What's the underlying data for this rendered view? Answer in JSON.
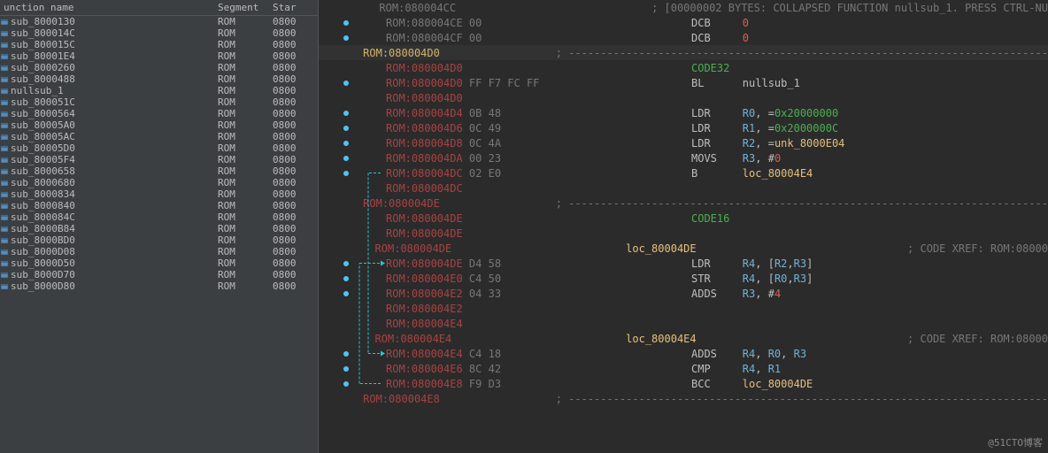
{
  "header": {
    "name": "unction name",
    "segment": "Segment",
    "star": "Star"
  },
  "functions": [
    {
      "name": "sub_8000130",
      "seg": "ROM",
      "star": "0800"
    },
    {
      "name": "sub_800014C",
      "seg": "ROM",
      "star": "0800"
    },
    {
      "name": "sub_800015C",
      "seg": "ROM",
      "star": "0800"
    },
    {
      "name": "sub_80001E4",
      "seg": "ROM",
      "star": "0800"
    },
    {
      "name": "sub_8000260",
      "seg": "ROM",
      "star": "0800"
    },
    {
      "name": "sub_8000488",
      "seg": "ROM",
      "star": "0800"
    },
    {
      "name": "nullsub_1",
      "seg": "ROM",
      "star": "0800"
    },
    {
      "name": "sub_800051C",
      "seg": "ROM",
      "star": "0800"
    },
    {
      "name": "sub_8000564",
      "seg": "ROM",
      "star": "0800"
    },
    {
      "name": "sub_80005A0",
      "seg": "ROM",
      "star": "0800"
    },
    {
      "name": "sub_80005AC",
      "seg": "ROM",
      "star": "0800"
    },
    {
      "name": "sub_80005D0",
      "seg": "ROM",
      "star": "0800"
    },
    {
      "name": "sub_80005F4",
      "seg": "ROM",
      "star": "0800"
    },
    {
      "name": "sub_8000658",
      "seg": "ROM",
      "star": "0800"
    },
    {
      "name": "sub_8000680",
      "seg": "ROM",
      "star": "0800"
    },
    {
      "name": "sub_8000834",
      "seg": "ROM",
      "star": "0800"
    },
    {
      "name": "sub_8000840",
      "seg": "ROM",
      "star": "0800"
    },
    {
      "name": "sub_800084C",
      "seg": "ROM",
      "star": "0800"
    },
    {
      "name": "sub_8000B84",
      "seg": "ROM",
      "star": "0800"
    },
    {
      "name": "sub_8000BD0",
      "seg": "ROM",
      "star": "0800"
    },
    {
      "name": "sub_8000D08",
      "seg": "ROM",
      "star": "0800"
    },
    {
      "name": "sub_8000D50",
      "seg": "ROM",
      "star": "0800"
    },
    {
      "name": "sub_8000D70",
      "seg": "ROM",
      "star": "0800"
    },
    {
      "name": "sub_8000D80",
      "seg": "ROM",
      "star": "0800"
    }
  ],
  "code": [
    {
      "dot": false,
      "romClass": "rom-gray",
      "addr": "ROM:080004CC",
      "bytes": "",
      "asm": "; [00000002 BYTES: COLLAPSED FUNCTION nullsub_1. PRESS CTRL-NU",
      "asmClass": "comment"
    },
    {
      "dot": true,
      "romClass": "rom-gray",
      "addr": "ROM:080004CE",
      "bytes": "00",
      "asmParts": [
        {
          "t": "DCB     ",
          "c": "mnemonic"
        },
        {
          "t": "0",
          "c": "num"
        }
      ]
    },
    {
      "dot": true,
      "romClass": "rom-gray",
      "addr": "ROM:080004CF",
      "bytes": "00",
      "asmParts": [
        {
          "t": "DCB     ",
          "c": "mnemonic"
        },
        {
          "t": "0",
          "c": "num"
        }
      ]
    },
    {
      "dot": false,
      "romClass": "rom-brown",
      "addr": "ROM:080004D0",
      "bytes": "",
      "asm": "; ---------------------------------------------------------------------------",
      "asmClass": "comment",
      "hl": true
    },
    {
      "dot": false,
      "romClass": "rom-red",
      "addr": "ROM:080004D0",
      "bytes": "",
      "asmParts": [
        {
          "t": "CODE32",
          "c": "cgreen"
        }
      ]
    },
    {
      "dot": true,
      "romClass": "rom-red",
      "addr": "ROM:080004D0",
      "bytes": "FF F7 FC FF",
      "asmParts": [
        {
          "t": "BL      ",
          "c": "mnemonic"
        },
        {
          "t": "nullsub_1",
          "c": "mnemonic"
        }
      ]
    },
    {
      "dot": false,
      "romClass": "rom-red",
      "addr": "ROM:080004D0",
      "bytes": "",
      "asm": "",
      "asmClass": ""
    },
    {
      "dot": true,
      "romClass": "rom-red",
      "addr": "ROM:080004D4",
      "bytes": "0B 48",
      "asmParts": [
        {
          "t": "LDR     ",
          "c": "mnemonic"
        },
        {
          "t": "R0",
          "c": "reg"
        },
        {
          "t": ", =",
          "c": "mnemonic"
        },
        {
          "t": "0x20000000",
          "c": "xaddr"
        }
      ]
    },
    {
      "dot": true,
      "romClass": "rom-red",
      "addr": "ROM:080004D6",
      "bytes": "0C 49",
      "asmParts": [
        {
          "t": "LDR     ",
          "c": "mnemonic"
        },
        {
          "t": "R1",
          "c": "reg"
        },
        {
          "t": ", =",
          "c": "mnemonic"
        },
        {
          "t": "0x2000000C",
          "c": "xaddr"
        }
      ]
    },
    {
      "dot": true,
      "romClass": "rom-red",
      "addr": "ROM:080004D8",
      "bytes": "0C 4A",
      "asmParts": [
        {
          "t": "LDR     ",
          "c": "mnemonic"
        },
        {
          "t": "R2",
          "c": "reg"
        },
        {
          "t": ", =",
          "c": "mnemonic"
        },
        {
          "t": "unk_8000E04",
          "c": "loc"
        }
      ]
    },
    {
      "dot": true,
      "romClass": "rom-red",
      "addr": "ROM:080004DA",
      "bytes": "00 23",
      "asmParts": [
        {
          "t": "MOVS    ",
          "c": "mnemonic"
        },
        {
          "t": "R3",
          "c": "reg"
        },
        {
          "t": ", #",
          "c": "mnemonic"
        },
        {
          "t": "0",
          "c": "num"
        }
      ]
    },
    {
      "dot": true,
      "romClass": "rom-red",
      "addr": "ROM:080004DC",
      "bytes": "02 E0",
      "asmParts": [
        {
          "t": "B       ",
          "c": "mnemonic"
        },
        {
          "t": "loc_80004E4",
          "c": "loc"
        }
      ],
      "branchOut": true
    },
    {
      "dot": false,
      "romClass": "rom-red",
      "addr": "ROM:080004DC",
      "bytes": "",
      "asm": "",
      "asmClass": ""
    },
    {
      "dot": false,
      "romClass": "rom-red",
      "addr": "ROM:080004DE",
      "bytes": "",
      "asm": "; ---------------------------------------------------------------------------",
      "asmClass": "comment"
    },
    {
      "dot": false,
      "romClass": "rom-red",
      "addr": "ROM:080004DE",
      "bytes": "",
      "asmParts": [
        {
          "t": "CODE16",
          "c": "cgreen"
        }
      ]
    },
    {
      "dot": false,
      "romClass": "rom-red",
      "addr": "ROM:080004DE",
      "bytes": "",
      "asm": "",
      "asmClass": ""
    },
    {
      "dot": false,
      "romClass": "rom-red",
      "addr": "ROM:080004DE",
      "bytes": "",
      "asmParts": [
        {
          "t": "loc_80004DE",
          "c": "loc"
        }
      ],
      "xref": "; CODE XREF: ROM:08000"
    },
    {
      "dot": true,
      "romClass": "rom-red",
      "addr": "ROM:080004DE",
      "bytes": "D4 58",
      "asmParts": [
        {
          "t": "LDR     ",
          "c": "mnemonic"
        },
        {
          "t": "R4",
          "c": "reg"
        },
        {
          "t": ", [",
          "c": "mnemonic"
        },
        {
          "t": "R2",
          "c": "reg"
        },
        {
          "t": ",",
          "c": "mnemonic"
        },
        {
          "t": "R3",
          "c": "reg"
        },
        {
          "t": "]",
          "c": "mnemonic"
        }
      ],
      "branchOut": true
    },
    {
      "dot": true,
      "romClass": "rom-red",
      "addr": "ROM:080004E0",
      "bytes": "C4 50",
      "asmParts": [
        {
          "t": "STR     ",
          "c": "mnemonic"
        },
        {
          "t": "R4",
          "c": "reg"
        },
        {
          "t": ", [",
          "c": "mnemonic"
        },
        {
          "t": "R0",
          "c": "reg"
        },
        {
          "t": ",",
          "c": "mnemonic"
        },
        {
          "t": "R3",
          "c": "reg"
        },
        {
          "t": "]",
          "c": "mnemonic"
        }
      ]
    },
    {
      "dot": true,
      "romClass": "rom-red",
      "addr": "ROM:080004E2",
      "bytes": "04 33",
      "asmParts": [
        {
          "t": "ADDS    ",
          "c": "mnemonic"
        },
        {
          "t": "R3",
          "c": "reg"
        },
        {
          "t": ", #",
          "c": "mnemonic"
        },
        {
          "t": "4",
          "c": "num"
        }
      ]
    },
    {
      "dot": false,
      "romClass": "rom-red",
      "addr": "ROM:080004E2",
      "bytes": "",
      "asm": "",
      "asmClass": ""
    },
    {
      "dot": false,
      "romClass": "rom-red",
      "addr": "ROM:080004E4",
      "bytes": "",
      "asm": "",
      "asmClass": ""
    },
    {
      "dot": false,
      "romClass": "rom-red",
      "addr": "ROM:080004E4",
      "bytes": "",
      "asmParts": [
        {
          "t": "loc_80004E4",
          "c": "loc"
        }
      ],
      "xref": "; CODE XREF: ROM:08000"
    },
    {
      "dot": true,
      "romClass": "rom-red",
      "addr": "ROM:080004E4",
      "bytes": "C4 18",
      "asmParts": [
        {
          "t": "ADDS    ",
          "c": "mnemonic"
        },
        {
          "t": "R4",
          "c": "reg"
        },
        {
          "t": ", ",
          "c": "mnemonic"
        },
        {
          "t": "R0",
          "c": "reg"
        },
        {
          "t": ", ",
          "c": "mnemonic"
        },
        {
          "t": "R3",
          "c": "reg"
        }
      ],
      "branchOut": true
    },
    {
      "dot": true,
      "romClass": "rom-red",
      "addr": "ROM:080004E6",
      "bytes": "8C 42",
      "asmParts": [
        {
          "t": "CMP     ",
          "c": "mnemonic"
        },
        {
          "t": "R4",
          "c": "reg"
        },
        {
          "t": ", ",
          "c": "mnemonic"
        },
        {
          "t": "R1",
          "c": "reg"
        }
      ]
    },
    {
      "dot": true,
      "romClass": "rom-red",
      "addr": "ROM:080004E8",
      "bytes": "F9 D3",
      "asmParts": [
        {
          "t": "BCC     ",
          "c": "mnemonic"
        },
        {
          "t": "loc_80004DE",
          "c": "loc"
        }
      ],
      "branchOut": true
    },
    {
      "dot": false,
      "romClass": "rom-red",
      "addr": "ROM:080004E8",
      "bytes": "",
      "asm": "; ---------------------------------------------------------------------------",
      "asmClass": "comment"
    }
  ],
  "watermark": "@51CTO博客"
}
